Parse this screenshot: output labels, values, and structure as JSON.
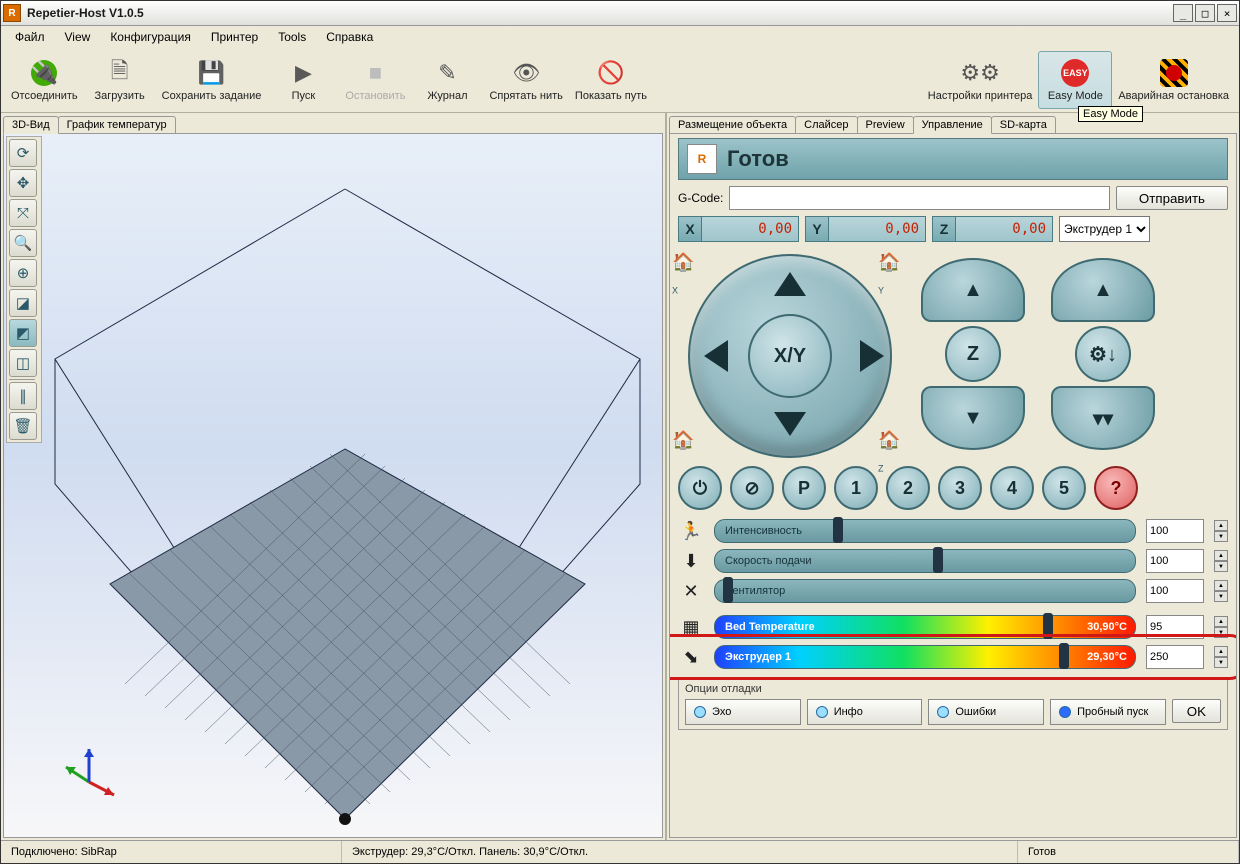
{
  "window_title": "Repetier-Host V1.0.5",
  "menu": [
    "Файл",
    "View",
    "Конфигурация",
    "Принтер",
    "Tools",
    "Справка"
  ],
  "toolbar": [
    {
      "id": "disconnect",
      "label": "Отсоединить",
      "icon": "🔌",
      "color": "#43a905"
    },
    {
      "id": "load",
      "label": "Загрузить",
      "icon": "🗎",
      "color": "#555"
    },
    {
      "id": "savejob",
      "label": "Сохранить задание",
      "icon": "💾",
      "color": "#555"
    },
    {
      "id": "run",
      "label": "Пуск",
      "icon": "▶",
      "color": "#5a5a5a"
    },
    {
      "id": "stop",
      "label": "Остановить",
      "icon": "■",
      "color": "#bdbdbd",
      "disabled": true
    },
    {
      "id": "log",
      "label": "Журнал",
      "icon": "✎",
      "color": "#555"
    },
    {
      "id": "hide",
      "label": "Спрятать нить",
      "icon": "👁",
      "color": "#555"
    },
    {
      "id": "showpath",
      "label": "Показать путь",
      "icon": "🚫",
      "color": "#555"
    },
    {
      "id": "spacer",
      "spacer": true
    },
    {
      "id": "psettings",
      "label": "Настройки принтера",
      "icon": "⚙⚙",
      "color": "#555"
    },
    {
      "id": "easy",
      "label": "Easy Mode",
      "icon": "EASY",
      "color": "#e02a2a",
      "active": true
    },
    {
      "id": "estop",
      "label": "Аварийная остановка",
      "icon": "◯",
      "color": "#ff7a00"
    }
  ],
  "tooltip": "Easy Mode",
  "left_tabs": [
    "3D-Вид",
    "График температур"
  ],
  "left_active": 0,
  "right_tabs": [
    "Размещение объекта",
    "Слайсер",
    "Preview",
    "Управление",
    "SD-карта"
  ],
  "right_active": 3,
  "status_banner": "Готов",
  "gcode_label": "G-Code:",
  "send_label": "Отправить",
  "coords": {
    "x": "0,00",
    "y": "0,00",
    "z": "0,00"
  },
  "extruder_select": "Экструдер 1",
  "jog_center": "X/Y",
  "jog_z": "Z",
  "cmd_buttons": [
    "⏻",
    "⊘",
    "P",
    "1",
    "2",
    "3",
    "4",
    "5",
    "?"
  ],
  "sliders": [
    {
      "id": "speed",
      "icon": "🏃",
      "label": "Интенсивность",
      "value": "100",
      "thumb": 28
    },
    {
      "id": "feed",
      "icon": "⬇",
      "label": "Скорость подачи",
      "value": "100",
      "thumb": 52
    },
    {
      "id": "fan",
      "icon": "✕",
      "label": "Вентилятор",
      "value": "100",
      "thumb": 2
    }
  ],
  "temps": [
    {
      "id": "bed",
      "icon": "▦",
      "label": "Bed Temperature",
      "reading": "30,90°C",
      "value": "95",
      "thumb": 78
    },
    {
      "id": "ext",
      "icon": "⬊",
      "label": "Экструдер 1",
      "reading": "29,30°C",
      "value": "250",
      "thumb": 82,
      "highlight": true
    }
  ],
  "debug": {
    "title": "Опции отладки",
    "items": [
      "Эхо",
      "Инфо",
      "Ошибки",
      "Пробный пуск"
    ],
    "active": 3,
    "ok": "OK"
  },
  "statusbar": {
    "conn": "Подключено: SibRap",
    "center": "Экструдер: 29,3°C/Откл. Панель: 30,9°C/Откл.",
    "right": "Готов"
  }
}
